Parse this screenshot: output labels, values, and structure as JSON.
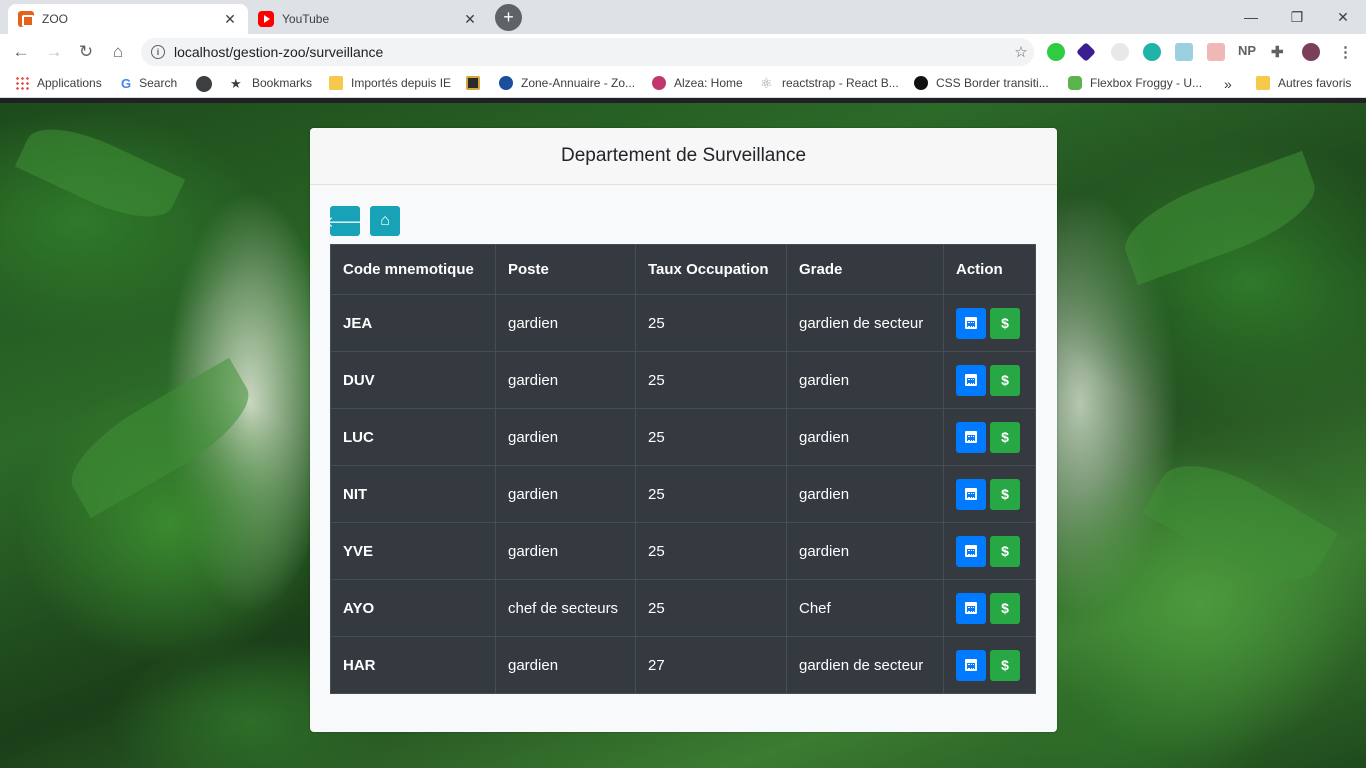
{
  "tabs": [
    {
      "title": "ZOO",
      "icon": "xampp-icon",
      "active": true
    },
    {
      "title": "YouTube",
      "icon": "youtube-icon",
      "active": false
    }
  ],
  "address": {
    "url": "localhost/gestion-zoo/surveillance"
  },
  "extensions": {
    "np_label": "NP"
  },
  "bookmarks": {
    "items": [
      {
        "label": "Applications"
      },
      {
        "label": "Search"
      },
      {
        "label": ""
      },
      {
        "label": "Bookmarks"
      },
      {
        "label": "Importés depuis IE"
      },
      {
        "label": ""
      },
      {
        "label": "Zone-Annuaire - Zo..."
      },
      {
        "label": "Alzea: Home"
      },
      {
        "label": "reactstrap - React B..."
      },
      {
        "label": "CSS Border transiti..."
      },
      {
        "label": "Flexbox Froggy - U..."
      }
    ],
    "overflow": "»",
    "other": "Autres favoris"
  },
  "card": {
    "title": "Departement de Surveillance"
  },
  "table": {
    "headers": [
      "Code mnemotique",
      "Poste",
      "Taux Occupation",
      "Grade",
      "Action"
    ],
    "rows": [
      {
        "code": "JEA",
        "poste": "gardien",
        "taux": "25",
        "grade": "gardien de secteur"
      },
      {
        "code": "DUV",
        "poste": "gardien",
        "taux": "25",
        "grade": "gardien"
      },
      {
        "code": "LUC",
        "poste": "gardien",
        "taux": "25",
        "grade": "gardien"
      },
      {
        "code": "NIT",
        "poste": "gardien",
        "taux": "25",
        "grade": "gardien"
      },
      {
        "code": "YVE",
        "poste": "gardien",
        "taux": "25",
        "grade": "gardien"
      },
      {
        "code": "AYO",
        "poste": "chef de secteurs",
        "taux": "25",
        "grade": "Chef"
      },
      {
        "code": "HAR",
        "poste": "gardien",
        "taux": "27",
        "grade": "gardien de secteur"
      }
    ],
    "action_icons": [
      "calendar-icon",
      "dollar-icon"
    ]
  },
  "colors": {
    "info": "#17a2b8",
    "primary": "#007bff",
    "success": "#28a745",
    "table_dark": "#343a40"
  }
}
